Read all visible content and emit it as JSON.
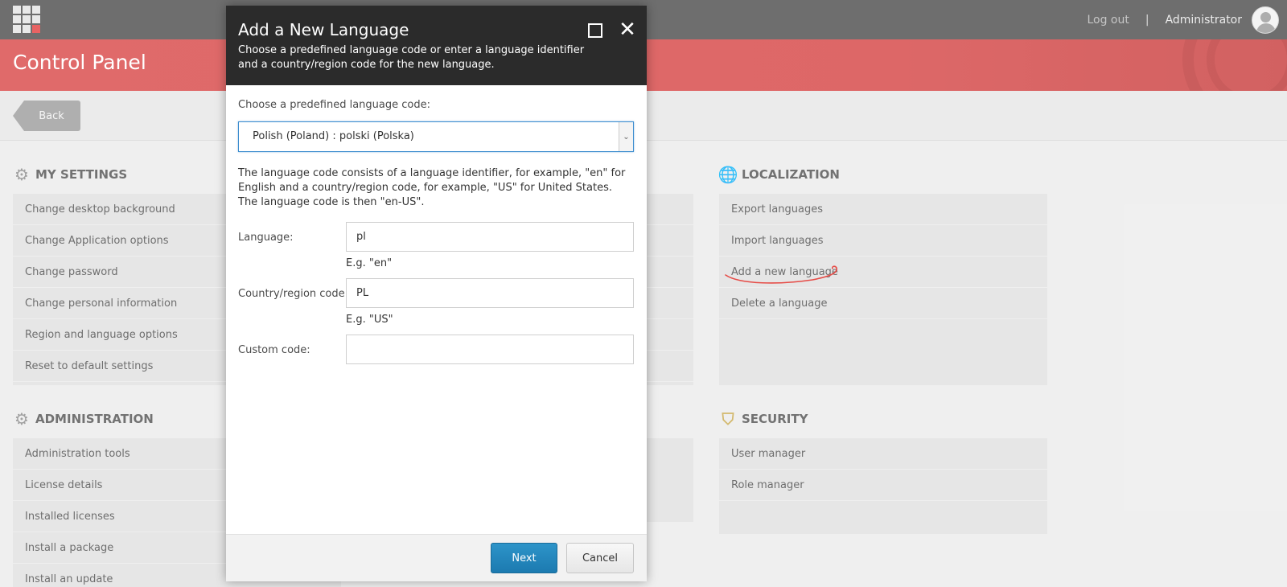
{
  "topbar": {
    "logout": "Log out",
    "separator": "|",
    "user": "Administrator"
  },
  "header": {
    "title": "Control Panel"
  },
  "toolbar": {
    "back": "Back"
  },
  "sections": {
    "my_settings": {
      "title": "MY SETTINGS",
      "icon": "gear-icon",
      "items": [
        "Change desktop background",
        "Change Application options",
        "Change password",
        "Change personal information",
        "Region and language options",
        "Reset to default settings"
      ]
    },
    "administration": {
      "title": "ADMINISTRATION",
      "icon": "gears-icon",
      "items": [
        "Administration tools",
        "License details",
        "Installed licenses",
        "Install a package",
        "Install an update"
      ]
    },
    "localization": {
      "title": "LOCALIZATION",
      "icon": "globe-icon",
      "items": [
        "Export languages",
        "Import languages",
        "Add a new language",
        "Delete a language"
      ]
    },
    "security": {
      "title": "SECURITY",
      "icon": "shield-icon",
      "items": [
        "User manager",
        "Role manager"
      ]
    }
  },
  "dialog": {
    "title": "Add a New Language",
    "subtitle": "Choose a predefined language code or enter a language identifier and a country/region code for the new language.",
    "choose_label": "Choose a predefined language code:",
    "selected_language": "Polish (Poland) : polski (Polska)",
    "description": "The language code consists of a language identifier, for example, \"en\" for English and a country/region code, for example, \"US\" for United States. The language code is then \"en-US\".",
    "language_label": "Language:",
    "language_value": "pl",
    "language_hint": "E.g. \"en\"",
    "country_label": "Country/region code:",
    "country_value": "PL",
    "country_hint": "E.g. \"US\"",
    "custom_label": "Custom code:",
    "custom_value": "",
    "next": "Next",
    "cancel": "Cancel"
  },
  "colors": {
    "topbar": "#4a4a4a",
    "brand_red": "#d94545",
    "dialog_header": "#2b2b2b",
    "primary_button": "#2288bf",
    "annotation": "#e0201a"
  }
}
